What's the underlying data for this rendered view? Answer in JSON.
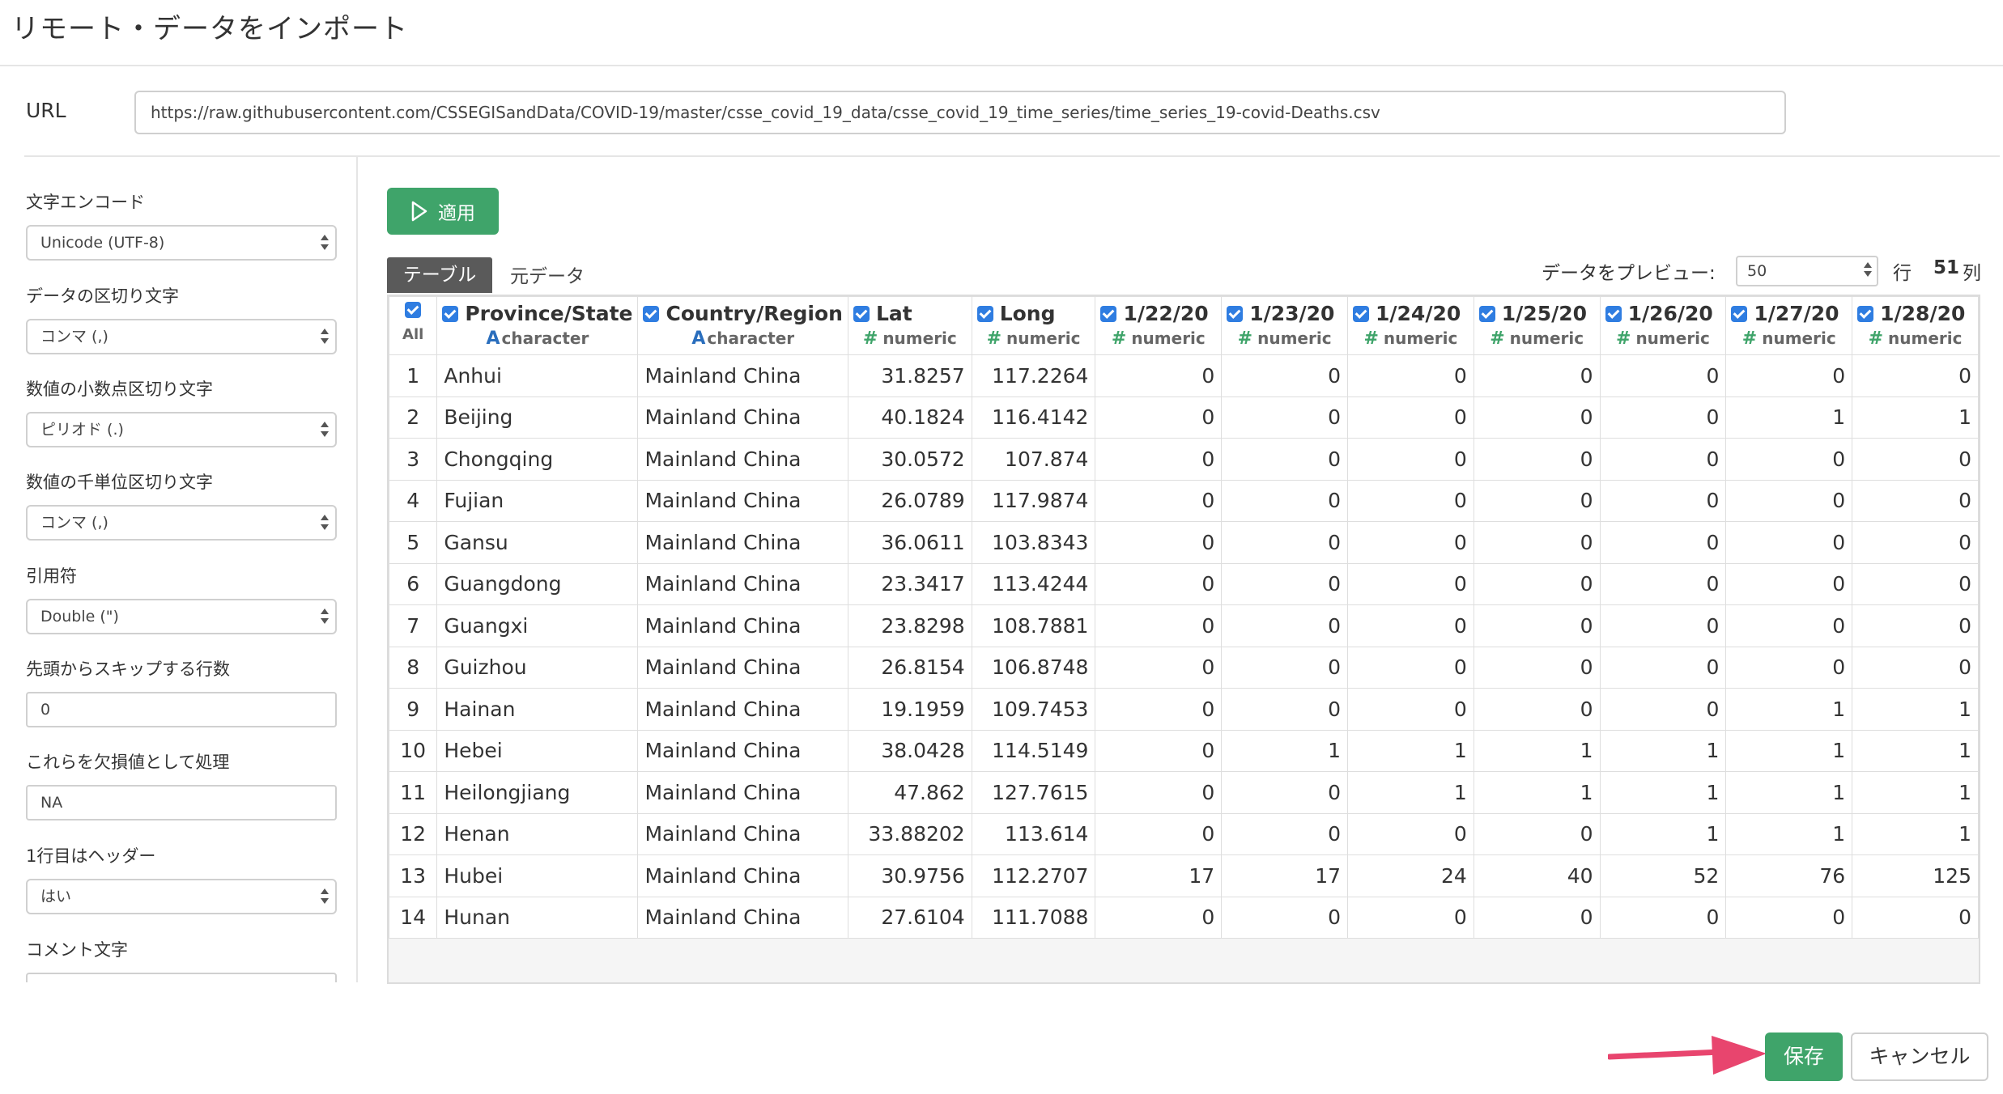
{
  "dialog": {
    "title": "リモート・データをインポート"
  },
  "url": {
    "label": "URL",
    "value": "https://raw.githubusercontent.com/CSSEGISandData/COVID-19/master/csse_covid_19_data/csse_covid_19_time_series/time_series_19-covid-Deaths.csv"
  },
  "sidebar": {
    "encoding": {
      "label": "文字エンコード",
      "value": "Unicode (UTF-8)"
    },
    "delimiter": {
      "label": "データの区切り文字",
      "value": "コンマ (,)"
    },
    "decimal": {
      "label": "数値の小数点区切り文字",
      "value": "ピリオド (.)"
    },
    "thousands": {
      "label": "数値の千単位区切り文字",
      "value": "コンマ (,)"
    },
    "quote": {
      "label": "引用符",
      "value": "Double (\")"
    },
    "skip": {
      "label": "先頭からスキップする行数",
      "value": "0"
    },
    "na": {
      "label": "これらを欠損値として処理",
      "value": "NA"
    },
    "header": {
      "label": "1行目はヘッダー",
      "value": "はい"
    },
    "comment": {
      "label": "コメント文字"
    }
  },
  "toolbar": {
    "apply_label": "適用"
  },
  "tabs": {
    "table": "テーブル",
    "raw": "元データ"
  },
  "preview": {
    "label": "データをプレビュー:",
    "value": "50",
    "rows_unit": "行",
    "col_count": "51",
    "col_unit": "列"
  },
  "table": {
    "all_label": "All",
    "columns": [
      {
        "name": "Province/State",
        "type": "character",
        "type_icon": "A"
      },
      {
        "name": "Country/Region",
        "type": "character",
        "type_icon": "A"
      },
      {
        "name": "Lat",
        "type": "numeric",
        "type_icon": "#"
      },
      {
        "name": "Long",
        "type": "numeric",
        "type_icon": "#"
      },
      {
        "name": "1/22/20",
        "type": "numeric",
        "type_icon": "#"
      },
      {
        "name": "1/23/20",
        "type": "numeric",
        "type_icon": "#"
      },
      {
        "name": "1/24/20",
        "type": "numeric",
        "type_icon": "#"
      },
      {
        "name": "1/25/20",
        "type": "numeric",
        "type_icon": "#"
      },
      {
        "name": "1/26/20",
        "type": "numeric",
        "type_icon": "#"
      },
      {
        "name": "1/27/20",
        "type": "numeric",
        "type_icon": "#"
      },
      {
        "name": "1/28/20",
        "type": "numeric",
        "type_icon": "#"
      }
    ],
    "rows": [
      [
        "1",
        "Anhui",
        "Mainland China",
        "31.8257",
        "117.2264",
        "0",
        "0",
        "0",
        "0",
        "0",
        "0",
        "0"
      ],
      [
        "2",
        "Beijing",
        "Mainland China",
        "40.1824",
        "116.4142",
        "0",
        "0",
        "0",
        "0",
        "0",
        "1",
        "1"
      ],
      [
        "3",
        "Chongqing",
        "Mainland China",
        "30.0572",
        "107.874",
        "0",
        "0",
        "0",
        "0",
        "0",
        "0",
        "0"
      ],
      [
        "4",
        "Fujian",
        "Mainland China",
        "26.0789",
        "117.9874",
        "0",
        "0",
        "0",
        "0",
        "0",
        "0",
        "0"
      ],
      [
        "5",
        "Gansu",
        "Mainland China",
        "36.0611",
        "103.8343",
        "0",
        "0",
        "0",
        "0",
        "0",
        "0",
        "0"
      ],
      [
        "6",
        "Guangdong",
        "Mainland China",
        "23.3417",
        "113.4244",
        "0",
        "0",
        "0",
        "0",
        "0",
        "0",
        "0"
      ],
      [
        "7",
        "Guangxi",
        "Mainland China",
        "23.8298",
        "108.7881",
        "0",
        "0",
        "0",
        "0",
        "0",
        "0",
        "0"
      ],
      [
        "8",
        "Guizhou",
        "Mainland China",
        "26.8154",
        "106.8748",
        "0",
        "0",
        "0",
        "0",
        "0",
        "0",
        "0"
      ],
      [
        "9",
        "Hainan",
        "Mainland China",
        "19.1959",
        "109.7453",
        "0",
        "0",
        "0",
        "0",
        "0",
        "1",
        "1"
      ],
      [
        "10",
        "Hebei",
        "Mainland China",
        "38.0428",
        "114.5149",
        "0",
        "1",
        "1",
        "1",
        "1",
        "1",
        "1"
      ],
      [
        "11",
        "Heilongjiang",
        "Mainland China",
        "47.862",
        "127.7615",
        "0",
        "0",
        "1",
        "1",
        "1",
        "1",
        "1"
      ],
      [
        "12",
        "Henan",
        "Mainland China",
        "33.88202",
        "113.614",
        "0",
        "0",
        "0",
        "0",
        "1",
        "1",
        "1"
      ],
      [
        "13",
        "Hubei",
        "Mainland China",
        "30.9756",
        "112.2707",
        "17",
        "17",
        "24",
        "40",
        "52",
        "76",
        "125"
      ],
      [
        "14",
        "Hunan",
        "Mainland China",
        "27.6104",
        "111.7088",
        "0",
        "0",
        "0",
        "0",
        "0",
        "0",
        "0"
      ]
    ]
  },
  "footer": {
    "save_label": "保存",
    "cancel_label": "キャンセル"
  },
  "colors": {
    "accent_green": "#3fa46a",
    "checkbox_blue": "#2f7de1",
    "annotation_pink": "#e8456e"
  }
}
